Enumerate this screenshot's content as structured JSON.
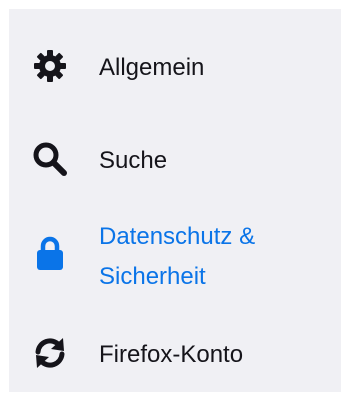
{
  "sidebar": {
    "items": [
      {
        "id": "general",
        "label": "Allgemein",
        "icon": "gear-icon",
        "active": false
      },
      {
        "id": "search",
        "label": "Suche",
        "icon": "search-icon",
        "active": false
      },
      {
        "id": "privacy",
        "label_line1": "Datenschutz &",
        "label_line2": "Sicherheit",
        "icon": "lock-icon",
        "active": true
      },
      {
        "id": "sync",
        "label": "Firefox-Konto",
        "icon": "sync-icon",
        "active": false
      }
    ]
  },
  "colors": {
    "sidebar_background": "#f0f0f4",
    "text": "#15141a",
    "active": "#0a74e8"
  }
}
